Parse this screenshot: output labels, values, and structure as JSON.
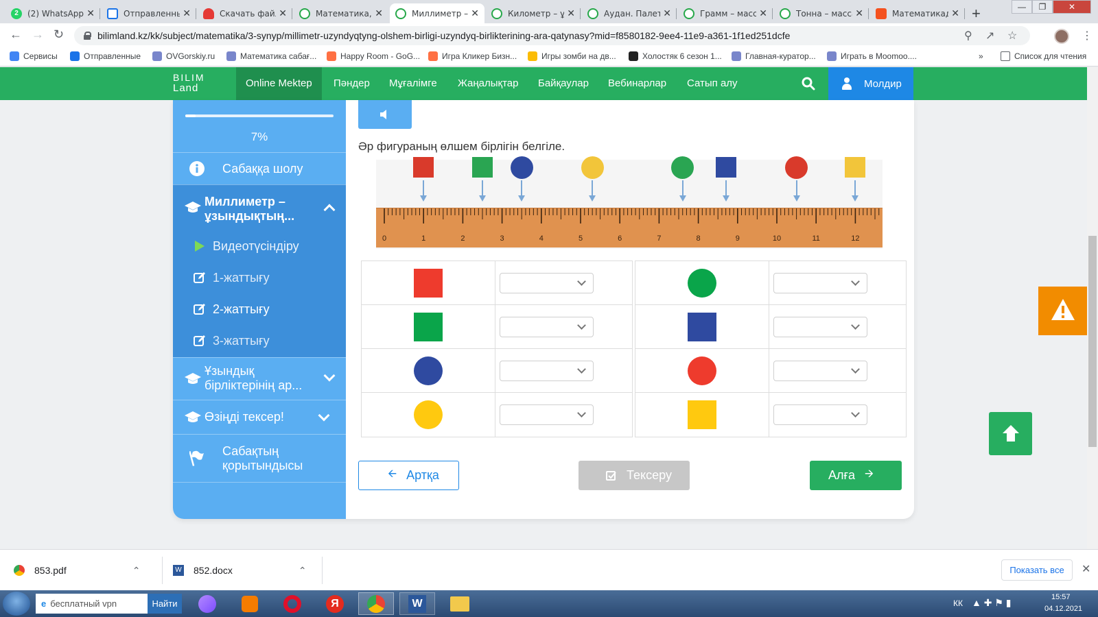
{
  "browser": {
    "tabs": [
      {
        "title": "(2) WhatsApp",
        "icon": "whatsapp-icon"
      },
      {
        "title": "Отправленные",
        "icon": "mail-icon"
      },
      {
        "title": "Скачать файл",
        "icon": "heart-icon"
      },
      {
        "title": "Математика, 3",
        "icon": "bilimland-icon"
      },
      {
        "title": "Миллиметр –",
        "icon": "bilimland-icon"
      },
      {
        "title": "Километр – ұ",
        "icon": "bilimland-icon"
      },
      {
        "title": "Аудан. Палетк",
        "icon": "bilimland-icon"
      },
      {
        "title": "Грамм – масса",
        "icon": "bilimland-icon"
      },
      {
        "title": "Тонна – масса",
        "icon": "bilimland-icon"
      },
      {
        "title": "Математикад",
        "icon": "play-icon"
      }
    ],
    "active_tab": 4,
    "url": "bilimland.kz/kk/subject/matematika/3-synyp/millimetr-uzyndyqtyng-olshem-birligi-uzyndyq-birlikterining-ara-qatynasy?mid=f8580182-9ee4-11e9-a361-1f1ed251dcfe",
    "bookmarks": [
      {
        "label": "Сервисы",
        "icon": "apps-icon"
      },
      {
        "label": "Отправленные",
        "icon": "mail-icon"
      },
      {
        "label": "OVGorskiy.ru",
        "icon": "site-icon"
      },
      {
        "label": "Математика сабағ...",
        "icon": "site-icon"
      },
      {
        "label": "Happy Room - GoG...",
        "icon": "game-icon"
      },
      {
        "label": "Игра Кликер Бизн...",
        "icon": "game-icon"
      },
      {
        "label": "Игры зомби на дв...",
        "icon": "google-icon"
      },
      {
        "label": "Холостяк 6 сезон 1...",
        "icon": "k-icon"
      },
      {
        "label": "Главная-куратор...",
        "icon": "site-icon"
      },
      {
        "label": "Играть в Moomoo....",
        "icon": "site-icon"
      }
    ],
    "bookmarks_more": "»",
    "reading_list": "Список для чтения"
  },
  "site": {
    "logo_line1": "BILIM",
    "logo_line2": "Land",
    "nav": [
      "Online Mektep",
      "Пәндер",
      "Мұғалімге",
      "Жаңалықтар",
      "Байқаулар",
      "Вебинарлар",
      "Сатып алу"
    ],
    "user_name": "Молдир",
    "brand_green": "#27ae60",
    "brand_blue": "#1e88e5"
  },
  "sidebar": {
    "progress_value": 0.07,
    "progress_text": "7%",
    "overview": "Сабаққа шолу",
    "section1": "Миллиметр – ұзындықтың...",
    "section1_line1": "Миллиметр –",
    "section1_line2": "ұзындықтың...",
    "subitems": [
      "Видеотүсіндіру",
      "1-жаттығу",
      "2-жаттығу",
      "3-жаттығу"
    ],
    "section2_line1": "Ұзындық",
    "section2_line2": "бірліктерінің ар...",
    "section3": "Өзіңді тексер!",
    "summary_line1": "Сабақтың",
    "summary_line2": "қорытындысы"
  },
  "exercise": {
    "question": "Әр фигураның өлшем бірлігін белгіле.",
    "ruler_labels": [
      "0",
      "1",
      "2",
      "3",
      "4",
      "5",
      "6",
      "7",
      "8",
      "9",
      "10",
      "11",
      "12"
    ],
    "markers": [
      {
        "shape": "square",
        "color": "#d93a2b",
        "position_cm": 1.0
      },
      {
        "shape": "square",
        "color": "#2aa552",
        "position_cm": 2.5
      },
      {
        "shape": "circle",
        "color": "#2f4aa0",
        "position_cm": 3.5
      },
      {
        "shape": "circle",
        "color": "#f2c53a",
        "position_cm": 5.3
      },
      {
        "shape": "circle",
        "color": "#2aa552",
        "position_cm": 7.6
      },
      {
        "shape": "square",
        "color": "#2f4aa0",
        "position_cm": 8.7
      },
      {
        "shape": "circle",
        "color": "#d93a2b",
        "position_cm": 10.5
      },
      {
        "shape": "square",
        "color": "#f2c53a",
        "position_cm": 12.0
      }
    ],
    "left_rows": [
      {
        "shape": "square",
        "color": "#ee3b2d",
        "answer": ""
      },
      {
        "shape": "square",
        "color": "#0aa54a",
        "answer": ""
      },
      {
        "shape": "circle",
        "color": "#2f4aa0",
        "answer": ""
      },
      {
        "shape": "circle",
        "color": "#ffc90f",
        "answer": ""
      }
    ],
    "right_rows": [
      {
        "shape": "circle",
        "color": "#0aa54a",
        "answer": ""
      },
      {
        "shape": "square",
        "color": "#2f4aa0",
        "answer": ""
      },
      {
        "shape": "circle",
        "color": "#ee3b2d",
        "answer": ""
      },
      {
        "shape": "square",
        "color": "#ffc90f",
        "answer": ""
      }
    ]
  },
  "buttons": {
    "back": "Артқа",
    "check": "Тексеру",
    "next": "Алға"
  },
  "downloads": {
    "items": [
      "853.pdf",
      "852.docx"
    ],
    "show_all": "Показать все"
  },
  "taskbar": {
    "search_placeholder": "бесплатный vpn",
    "search_button": "Найти",
    "lang": "КК",
    "time": "15:57",
    "date": "04.12.2021"
  }
}
